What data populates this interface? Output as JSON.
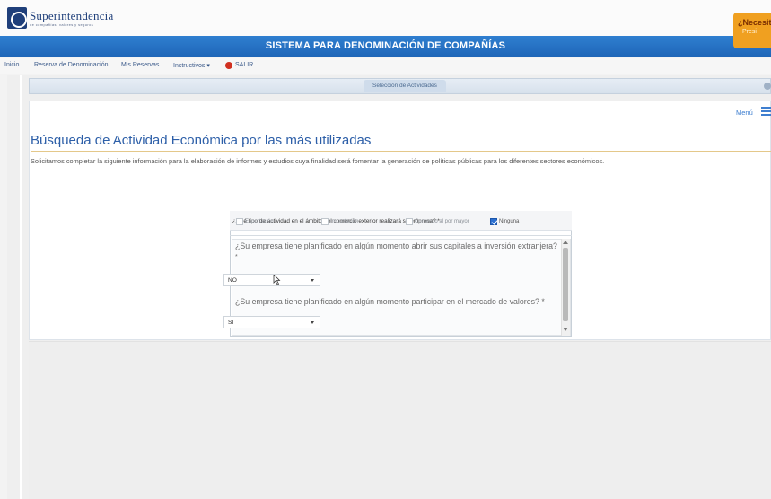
{
  "logo": {
    "text": "Superintendencia",
    "subtext": "de compañías, valores y seguros"
  },
  "help": {
    "title": "¿Necesita",
    "subtitle": "Presi"
  },
  "app_title": "SISTEMA PARA DENOMINACIÓN DE COMPAÑÍAS",
  "nav": {
    "inicio": "Inicio",
    "reserva": "Reserva de Denominación",
    "mis_reservas": "Mis Reservas",
    "instructivos": "Instructivos ▾",
    "salir": "SALIR"
  },
  "tab": {
    "label": "Selección de Actividades"
  },
  "menu_link": "Menú",
  "page": {
    "title": "Búsqueda de Actividad Económica por las más utilizadas",
    "intro": "Solicitamos completar la siguiente información para la elaboración de informes y estudios cuya finalidad será fomentar la generación de políticas públicas para los diferentes sectores económicos."
  },
  "form": {
    "q1": {
      "label": "¿Qué tipo de actividad en el ámbito del comercio exterior realizará su empresa? *",
      "options": [
        {
          "label": "Exportación",
          "checked": false
        },
        {
          "label": "Importación",
          "checked": false
        },
        {
          "label": "Comercio al por mayor",
          "checked": false
        },
        {
          "label": "Ninguna",
          "checked": true
        }
      ]
    },
    "q2": {
      "label": "¿Su empresa tiene planificado en algún momento abrir sus capitales a inversión extranjera?",
      "required_mark": "*",
      "value": "NO"
    },
    "q3": {
      "label": "¿Su empresa tiene planificado en algún momento participar en el mercado de valores? *",
      "value": "SI"
    }
  },
  "colors": {
    "primary": "#1f66b8",
    "title": "#2d5fa8",
    "accent": "#f0a020",
    "checked": "#2b6fd0"
  }
}
